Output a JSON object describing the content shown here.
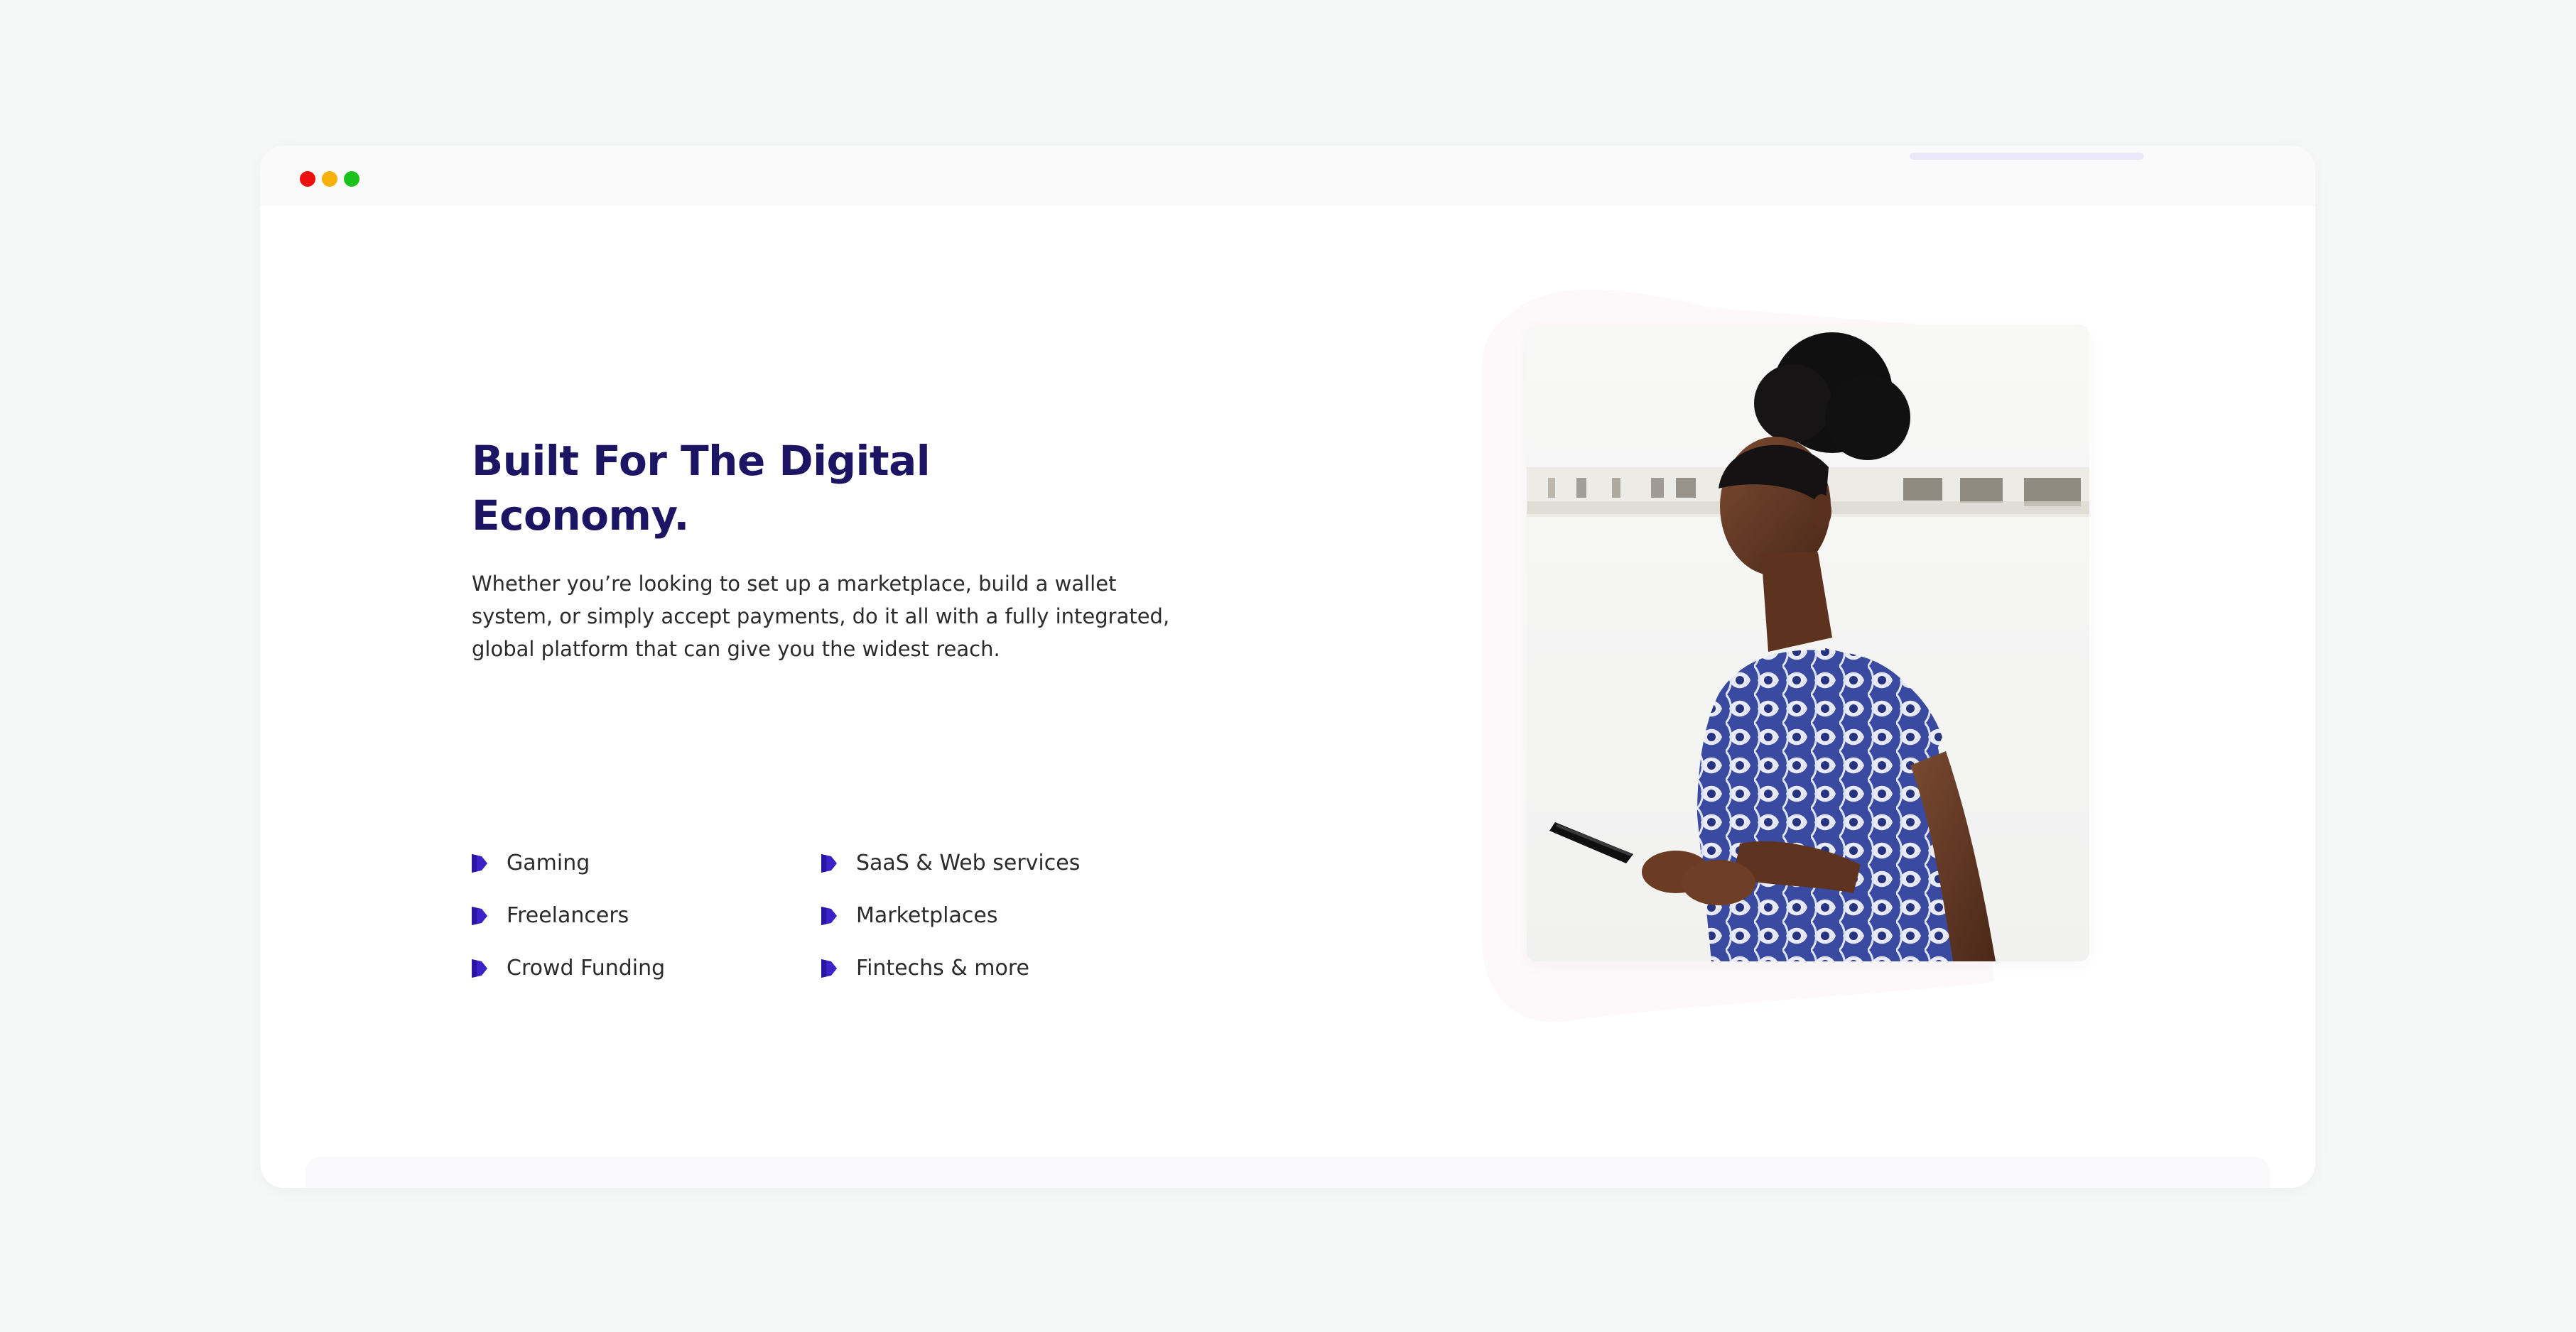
{
  "hero": {
    "title_line1": "Built For The Digital",
    "title_line2": "Economy.",
    "description_line1": "Whether you’re looking to set up a marketplace, build a wallet",
    "description_line2": "system, or simply accept payments, do it all with a fully integrated,",
    "description_line3": "global platform that can give you the widest reach."
  },
  "features": [
    {
      "label": "Gaming",
      "icon": "flag-bullet-icon"
    },
    {
      "label": "Freelancers",
      "icon": "flag-bullet-icon"
    },
    {
      "label": "Crowd Funding",
      "icon": "flag-bullet-icon"
    },
    {
      "label": "SaaS & Web services",
      "icon": "flag-bullet-icon"
    },
    {
      "label": "Marketplaces",
      "icon": "flag-bullet-icon"
    },
    {
      "label": "Fintechs & more",
      "icon": "flag-bullet-icon"
    }
  ],
  "colors": {
    "heading": "#1d1464",
    "accent": "#3a22c7",
    "window_dot_red": "#ef0e0e",
    "window_dot_yellow": "#f6b10a",
    "window_dot_green": "#1cc21c"
  },
  "image": {
    "subject": "woman-using-smartphone-photo"
  }
}
